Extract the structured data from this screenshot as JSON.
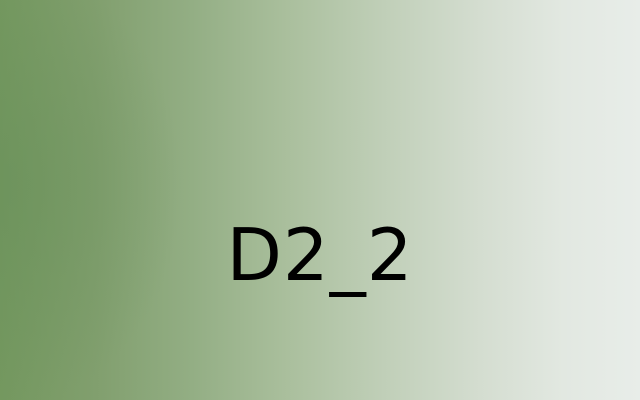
{
  "image": {
    "label": "D2_2",
    "text_color": "#000000",
    "background": {
      "style": "horizontal gradient with soft left glow",
      "colors": [
        "#74985f",
        "#93ae84",
        "#c0cfb8",
        "#e8ede9"
      ]
    }
  }
}
